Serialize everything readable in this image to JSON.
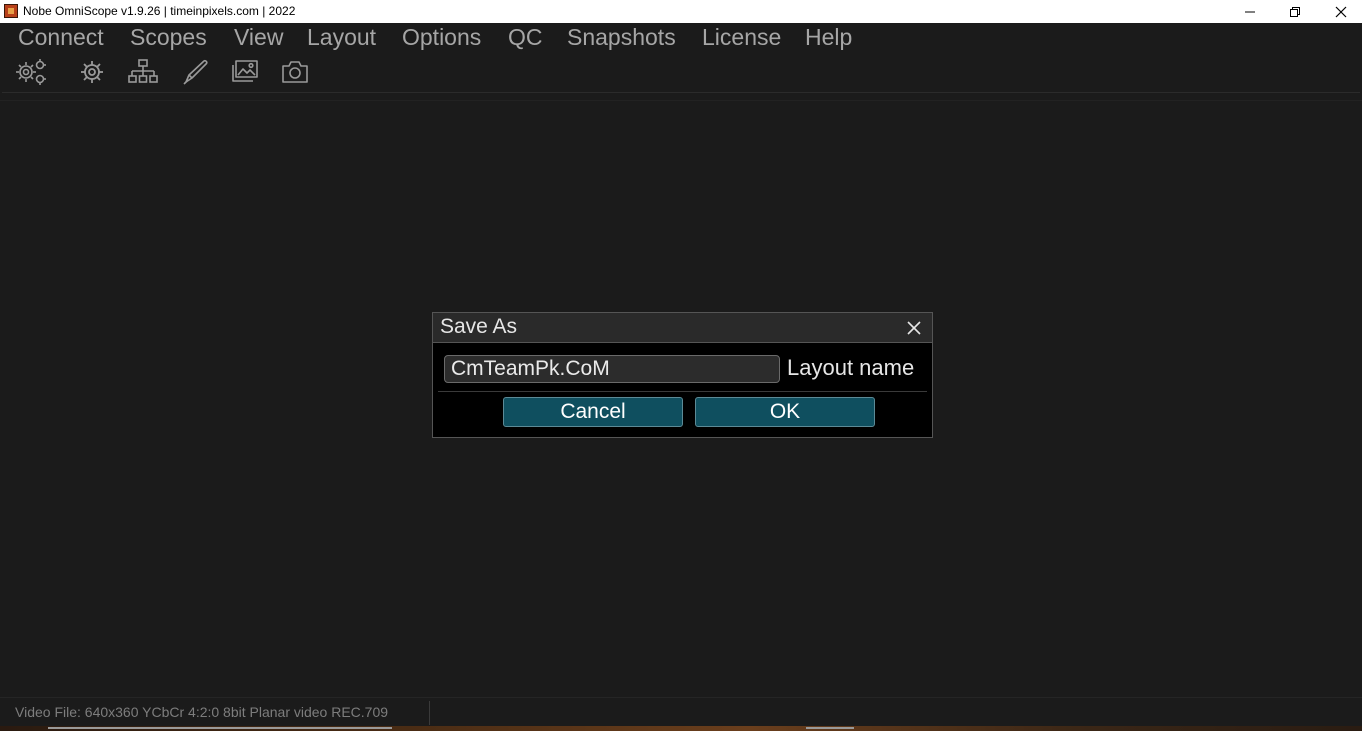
{
  "window": {
    "title": "Nobe OmniScope v1.9.26 | timeinpixels.com | 2022"
  },
  "menu": {
    "items": [
      "Connect",
      "Scopes",
      "View",
      "Layout",
      "Options",
      "QC",
      "Snapshots",
      "License",
      "Help"
    ]
  },
  "toolbar": {
    "icons": [
      "multi-gear-icon",
      "gear-icon",
      "network-icon",
      "pen-icon",
      "images-icon",
      "camera-icon"
    ]
  },
  "dialog": {
    "title": "Save As",
    "input_value": "CmTeamPk.CoM",
    "input_label": "Layout name",
    "cancel_label": "Cancel",
    "ok_label": "OK"
  },
  "status": {
    "text": "Video File: 640x360 YCbCr 4:2:0 8bit Planar video REC.709"
  },
  "colors": {
    "background": "#1b1b1b",
    "menu_text": "#a6a6a6",
    "button_fill": "#0f4f5f",
    "icon": "#9a9a9a"
  }
}
